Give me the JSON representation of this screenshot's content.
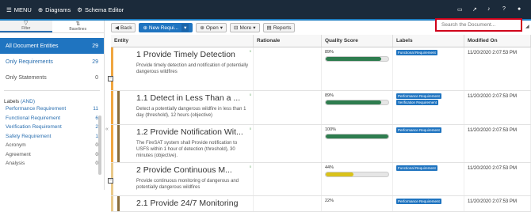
{
  "topbar": {
    "menu_label": "MENU",
    "diagrams_label": "Diagrams",
    "schema_label": "Schema Editor"
  },
  "sidebar": {
    "tabs": [
      {
        "label": "Filter"
      },
      {
        "label": "Baselines"
      }
    ],
    "nav": [
      {
        "label": "All Document Entities",
        "count": "29"
      },
      {
        "label": "Only Requirements",
        "count": "29"
      },
      {
        "label": "Only Statements",
        "count": "0"
      }
    ],
    "labels_title": "Labels",
    "labels_mode": "(AND)",
    "labels": [
      {
        "label": "Performance Requirement",
        "count": "11"
      },
      {
        "label": "Functional Requirement",
        "count": "6"
      },
      {
        "label": "Verification Requirement",
        "count": "2"
      },
      {
        "label": "Safety Requirement",
        "count": "1"
      },
      {
        "label": "Acronym",
        "count": "0"
      },
      {
        "label": "Agreement",
        "count": "0"
      },
      {
        "label": "Analysis",
        "count": "0"
      }
    ]
  },
  "toolbar": {
    "back": "Back",
    "new_req": "New Requi...",
    "open": "Open",
    "more": "More",
    "reports": "Reports"
  },
  "search": {
    "placeholder": "Search the Document..."
  },
  "grid": {
    "headers": {
      "entity": "Entity",
      "rationale": "Rationale",
      "quality": "Quality Score",
      "labels": "Labels",
      "modified": "Modified On"
    },
    "rows": [
      {
        "title": "1 Provide Timely Detection",
        "desc": "Provide timely detection and notification of potentially dangerous wildfires",
        "quality": "89%",
        "quality_value": 89,
        "quality_color": "#2e7d4f",
        "labels": [
          "Functional Requirement"
        ],
        "modified": "11/20/2020 2:07:53 PM",
        "level": 1
      },
      {
        "title": "1.1 Detect in Less Than a ...",
        "desc": "Detect a potentially dangerous wildfire in less than 1 day (threshold), 12 hours (objective)",
        "quality": "89%",
        "quality_value": 89,
        "quality_color": "#2e7d4f",
        "labels": [
          "Performance Requirement",
          "Verification Requirement"
        ],
        "modified": "11/20/2020 2:07:53 PM",
        "level": 2
      },
      {
        "title": "1.2 Provide Notification Wit...",
        "desc": "The FireSAT system shall Provide notification to USFS within 1 hour of detection (threshold), 30 minutes (objective).",
        "quality": "100%",
        "quality_value": 100,
        "quality_color": "#2e7d4f",
        "labels": [
          "Performance Requirement"
        ],
        "modified": "11/20/2020 2:07:53 PM",
        "level": 2
      },
      {
        "title": "2 Provide Continuous M...",
        "desc": "Provide continuous monitoring of dangerous and potentially dangerous wildfires",
        "quality": "44%",
        "quality_value": 44,
        "quality_color": "#d9c21a",
        "labels": [
          "Functional Requirement"
        ],
        "modified": "11/20/2020 2:07:53 PM",
        "level": 1
      },
      {
        "title": "2.1 Provide 24/7 Monitoring",
        "desc": "",
        "quality": "22%",
        "quality_value": 22,
        "quality_color": "#d9c21a",
        "labels": [
          "Performance Requirement"
        ],
        "modified": "11/20/2020 2:07:53 PM",
        "level": 2
      }
    ]
  },
  "colors": {
    "brand": "#1f74c0",
    "topbar": "#1b2a3a",
    "highlight": "#d0021b"
  }
}
